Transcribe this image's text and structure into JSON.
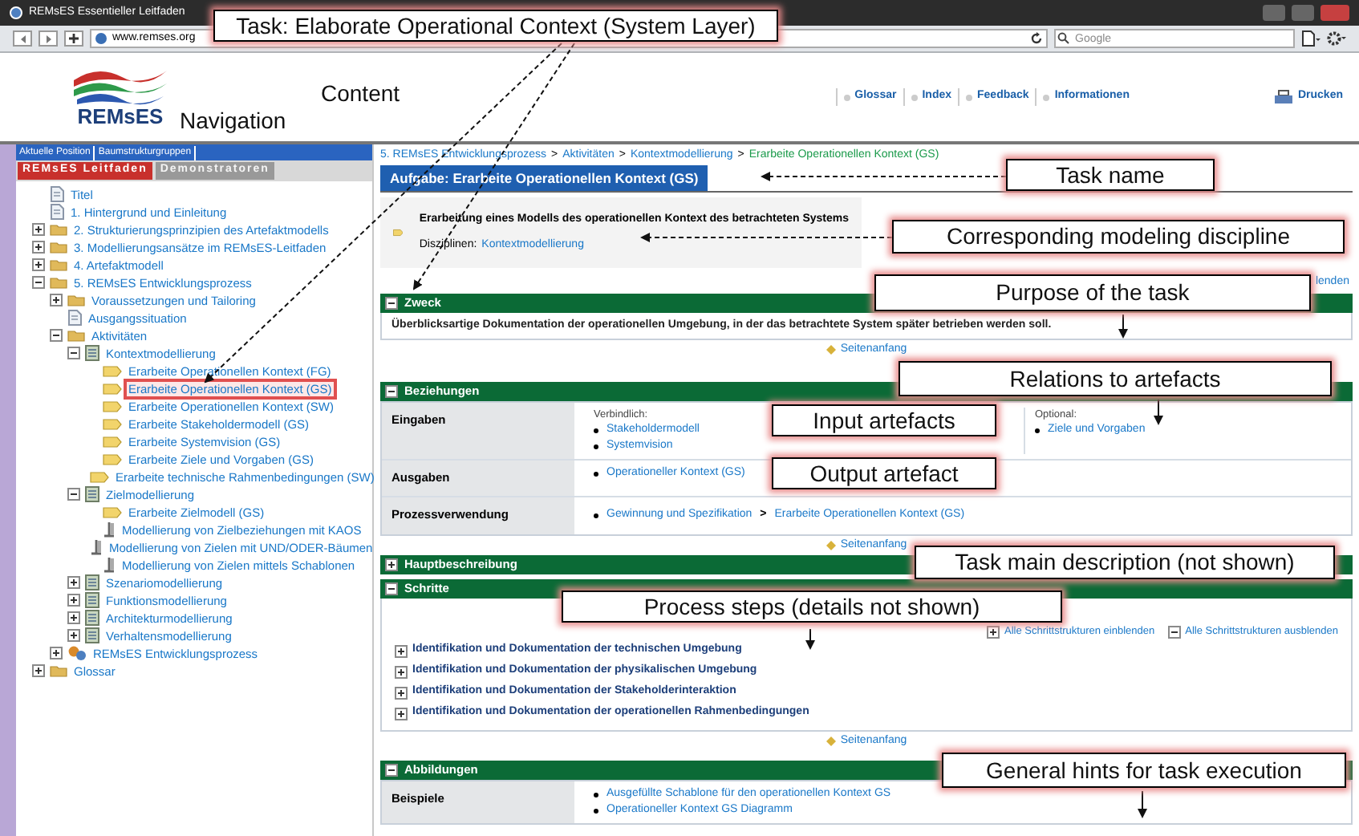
{
  "window": {
    "title": "REMsES Essentieller Leitfaden"
  },
  "browser": {
    "url": "www.remses.org",
    "search_placeholder": "Google"
  },
  "header": {
    "logo": "REMsES",
    "links": [
      "Glossar",
      "Index",
      "Feedback",
      "Informationen"
    ],
    "print": "Drucken"
  },
  "nav": {
    "top_tabs": [
      {
        "label": "Aktuelle Position",
        "selected": false
      },
      {
        "label": "Baumstrukturgruppen",
        "selected": false
      }
    ],
    "tabs": [
      {
        "label": "REMsES Leitfaden",
        "selected": true
      },
      {
        "label": "Demonstratoren",
        "selected": false
      }
    ],
    "tree": [
      {
        "label": "Titel",
        "kind": "page",
        "selected": false
      },
      {
        "label": "1. Hintergrund und Einleitung",
        "kind": "page",
        "selected": false
      },
      {
        "label": "2. Strukturierungsprinzipien des Artefaktmodells",
        "kind": "folder",
        "expanded": false,
        "selected": false
      },
      {
        "label": "3. Modellierungsansätze im REMsES-Leitfaden",
        "kind": "folder",
        "expanded": false,
        "selected": false
      },
      {
        "label": "4. Artefaktmodell",
        "kind": "folder",
        "expanded": false,
        "selected": false
      },
      {
        "label": "5. REMsES Entwicklungsprozess",
        "kind": "folder",
        "expanded": true,
        "selected": false,
        "children": [
          {
            "label": "Voraussetzungen und Tailoring",
            "kind": "folder",
            "expanded": false,
            "selected": false
          },
          {
            "label": "Ausgangssituation",
            "kind": "page",
            "selected": false
          },
          {
            "label": "Aktivitäten",
            "kind": "folder",
            "expanded": true,
            "selected": false,
            "children": [
              {
                "label": "Kontextmodellierung",
                "kind": "module",
                "expanded": true,
                "selected": false,
                "children": [
                  {
                    "label": "Erarbeite Operationellen Kontext (FG)",
                    "kind": "task",
                    "selected": false
                  },
                  {
                    "label": "Erarbeite Operationellen Kontext (GS)",
                    "kind": "task",
                    "selected": true
                  },
                  {
                    "label": "Erarbeite Operationellen Kontext (SW)",
                    "kind": "task",
                    "selected": false
                  },
                  {
                    "label": "Erarbeite Stakeholdermodell (GS)",
                    "kind": "task",
                    "selected": false
                  },
                  {
                    "label": "Erarbeite Systemvision (GS)",
                    "kind": "task",
                    "selected": false
                  },
                  {
                    "label": "Erarbeite Ziele und Vorgaben (GS)",
                    "kind": "task",
                    "selected": false
                  },
                  {
                    "label": "Erarbeite technische Rahmenbedingungen (SW)",
                    "kind": "task",
                    "selected": false
                  }
                ]
              },
              {
                "label": "Zielmodellierung",
                "kind": "module",
                "expanded": true,
                "selected": false,
                "children": [
                  {
                    "label": "Erarbeite Zielmodell (GS)",
                    "kind": "task",
                    "selected": false
                  },
                  {
                    "label": "Modellierung von Zielbeziehungen mit KAOS",
                    "kind": "method",
                    "selected": false
                  },
                  {
                    "label": "Modellierung von Zielen mit UND/ODER-Bäumen",
                    "kind": "method",
                    "selected": false
                  },
                  {
                    "label": "Modellierung von Zielen mittels Schablonen",
                    "kind": "method",
                    "selected": false
                  }
                ]
              },
              {
                "label": "Szenariomodellierung",
                "kind": "module",
                "expanded": false,
                "selected": false
              },
              {
                "label": "Funktionsmodellierung",
                "kind": "module",
                "expanded": false,
                "selected": false
              },
              {
                "label": "Architekturmodellierung",
                "kind": "module",
                "expanded": false,
                "selected": false
              },
              {
                "label": "Verhaltensmodellierung",
                "kind": "module",
                "expanded": false,
                "selected": false
              }
            ]
          },
          {
            "label": "REMsES Entwicklungsprozess",
            "kind": "process",
            "expanded": false,
            "selected": false
          }
        ]
      },
      {
        "label": "Glossar",
        "kind": "folder",
        "expanded": false,
        "selected": false
      }
    ]
  },
  "content": {
    "breadcrumb": [
      {
        "label": "5. REMsES Entwicklungsprozess",
        "current": false
      },
      {
        "label": "Aktivitäten",
        "current": false
      },
      {
        "label": "Kontextmodellierung",
        "current": false
      },
      {
        "label": "Erarbeite Operationellen Kontext (GS)",
        "current": true
      }
    ],
    "breadcrumb_separator": ">",
    "title": "Aufgabe: Erarbeite Operationellen Kontext (GS)",
    "description": "Erarbeitung eines Modells des operationellen Kontext des betrachteten Systems",
    "discipline_label": "Disziplinen:",
    "discipline": "Kontextmodellierung",
    "toggle_fragment": "lenden",
    "sections": [
      {
        "kind": "text",
        "title": "Zweck",
        "expanded": true,
        "text": "Überblicksartige Dokumentation der operationellen Umgebung, in der das betrachtete System später betrieben werden soll.",
        "top_link": "Seitenanfang"
      },
      {
        "kind": "table",
        "title": "Beziehungen",
        "expanded": true,
        "rows": [
          {
            "label": "Eingaben",
            "kind": "groups",
            "groups": [
              {
                "heading": "Verbindlich:",
                "items": [
                  "Stakeholdermodell",
                  "Systemvision"
                ]
              },
              {
                "heading": "Optional:",
                "items": [
                  "Ziele und Vorgaben"
                ]
              }
            ]
          },
          {
            "label": "Ausgaben",
            "kind": "groups",
            "groups": [
              {
                "items": [
                  "Operationeller Kontext (GS)"
                ]
              }
            ]
          },
          {
            "label": "Prozessverwendung",
            "kind": "path",
            "separator": ">",
            "items": [
              "Gewinnung und Spezifikation",
              "Erarbeite Operationellen Kontext (GS)"
            ]
          }
        ],
        "top_link": "Seitenanfang"
      },
      {
        "kind": "header",
        "title": "Hauptbeschreibung",
        "expanded": false
      },
      {
        "kind": "steps",
        "title": "Schritte",
        "expanded": true,
        "toggles": [
          "Alle Schrittstrukturen einblenden",
          "Alle Schrittstrukturen ausblenden"
        ],
        "steps": [
          {
            "label": "Identifikation und Dokumentation der technischen Umgebung",
            "expanded": false
          },
          {
            "label": "Identifikation und Dokumentation der physikalischen Umgebung",
            "expanded": false
          },
          {
            "label": "Identifikation und Dokumentation der Stakeholderinteraktion",
            "expanded": false
          },
          {
            "label": "Identifikation und Dokumentation der operationellen Rahmenbedingungen",
            "expanded": false
          }
        ],
        "top_link": "Seitenanfang"
      },
      {
        "kind": "table",
        "title": "Abbildungen",
        "expanded": true,
        "rows": [
          {
            "label": "Beispiele",
            "kind": "groups",
            "groups": [
              {
                "items": [
                  "Ausgefüllte Schablone für den operationellen Kontext GS",
                  "Operationeller Kontext GS Diagramm"
                ]
              }
            ]
          }
        ]
      }
    ]
  },
  "annotations": [
    {
      "text": "Task: Elaborate Operational Context (System Layer)",
      "kind": "box"
    },
    {
      "text": "Navigation",
      "kind": "plain"
    },
    {
      "text": "Content",
      "kind": "plain"
    },
    {
      "text": "Task name",
      "kind": "box"
    },
    {
      "text": "Corresponding modeling discipline",
      "kind": "box"
    },
    {
      "text": "Purpose of the task",
      "kind": "box"
    },
    {
      "text": "Relations to artefacts",
      "kind": "box"
    },
    {
      "text": "Input artefacts",
      "kind": "box"
    },
    {
      "text": "Output artefact",
      "kind": "box"
    },
    {
      "text": "Task main description (not shown)",
      "kind": "box"
    },
    {
      "text": "Process steps (details not shown)",
      "kind": "box"
    },
    {
      "text": "General hints for task execution",
      "kind": "box"
    }
  ]
}
